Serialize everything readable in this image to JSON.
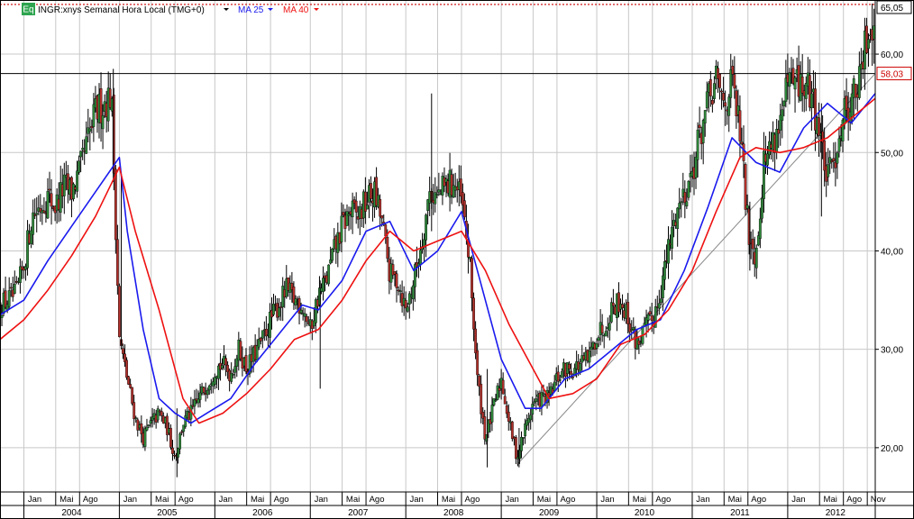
{
  "legend": {
    "badge": "Eq",
    "instrument": "INGR:xnys Semanal Hora Local (TMG+0)",
    "ma_short": "MA 25",
    "ma_long": "MA 40"
  },
  "chart_data": {
    "type": "candlestick",
    "title": "INGR:xnys Semanal Hora Local (TMG+0)",
    "x_axis": {
      "month_labels": [
        "Jan",
        "Mai",
        "Ago",
        "Jan",
        "Mai",
        "Ago",
        "Jan",
        "Mai",
        "Ago",
        "Jan",
        "Mai",
        "Ago",
        "Jan",
        "Mai",
        "Ago",
        "Jan",
        "Mai",
        "Ago",
        "Jan",
        "Mai",
        "Ago",
        "Jan",
        "Mai",
        "Ago",
        "Jan",
        "Mai",
        "Ago",
        "Nov"
      ],
      "year_labels": [
        "2004",
        "2005",
        "2006",
        "2007",
        "2008",
        "2009",
        "2010",
        "2011",
        "2012"
      ],
      "range": [
        "2003-10",
        "2012-12"
      ]
    },
    "y_axis": {
      "ticks": [
        "20,00",
        "30,00",
        "40,00",
        "50,00",
        "60,00"
      ],
      "tick_values": [
        20,
        30,
        40,
        50,
        60
      ],
      "range": [
        15.5,
        65.5
      ],
      "position": "right",
      "grid": true
    },
    "current_price": {
      "label": "65,05",
      "value": 65.05,
      "line_color": "#cc0000",
      "style": "dotted"
    },
    "horizontal_level": {
      "label": "58,03",
      "value": 58.03,
      "line_color": "#000000"
    },
    "trendline": {
      "from": {
        "date": "2009-03",
        "value": 18.3
      },
      "to": {
        "date": "2012-12",
        "value": 58.03
      },
      "color": "#888888"
    },
    "price_path": [
      {
        "d": "2003-10",
        "v": 34.5
      },
      {
        "d": "2003-12",
        "v": 35.5
      },
      {
        "d": "2004-01",
        "v": 38.5
      },
      {
        "d": "2004-02",
        "v": 43.5
      },
      {
        "d": "2004-03",
        "v": 44.5
      },
      {
        "d": "2004-04",
        "v": 45.5
      },
      {
        "d": "2004-05",
        "v": 44.5
      },
      {
        "d": "2004-06",
        "v": 46.5
      },
      {
        "d": "2004-07",
        "v": 46
      },
      {
        "d": "2004-08",
        "v": 48
      },
      {
        "d": "2004-09",
        "v": 51
      },
      {
        "d": "2004-10",
        "v": 54
      },
      {
        "d": "2004-11",
        "v": 55
      },
      {
        "d": "2004-12",
        "v": 56
      },
      {
        "d": "2005-01",
        "v": 31
      },
      {
        "d": "2005-02",
        "v": 27
      },
      {
        "d": "2005-03",
        "v": 23
      },
      {
        "d": "2005-04",
        "v": 21
      },
      {
        "d": "2005-05",
        "v": 22.5
      },
      {
        "d": "2005-06",
        "v": 23.5
      },
      {
        "d": "2005-07",
        "v": 22
      },
      {
        "d": "2005-08",
        "v": 19
      },
      {
        "d": "2005-09",
        "v": 22.5
      },
      {
        "d": "2005-10",
        "v": 23.5
      },
      {
        "d": "2005-11",
        "v": 25
      },
      {
        "d": "2005-12",
        "v": 26.5
      },
      {
        "d": "2006-01",
        "v": 28
      },
      {
        "d": "2006-02",
        "v": 28.5
      },
      {
        "d": "2006-03",
        "v": 27.5
      },
      {
        "d": "2006-04",
        "v": 30
      },
      {
        "d": "2006-05",
        "v": 28
      },
      {
        "d": "2006-06",
        "v": 29.5
      },
      {
        "d": "2006-07",
        "v": 31
      },
      {
        "d": "2006-08",
        "v": 33
      },
      {
        "d": "2006-09",
        "v": 34.5
      },
      {
        "d": "2006-10",
        "v": 36
      },
      {
        "d": "2006-11",
        "v": 35
      },
      {
        "d": "2006-12",
        "v": 34.5
      },
      {
        "d": "2007-01",
        "v": 32
      },
      {
        "d": "2007-02",
        "v": 35.5
      },
      {
        "d": "2007-03",
        "v": 37
      },
      {
        "d": "2007-04",
        "v": 40
      },
      {
        "d": "2007-05",
        "v": 42.5
      },
      {
        "d": "2007-06",
        "v": 44
      },
      {
        "d": "2007-07",
        "v": 43.5
      },
      {
        "d": "2007-08",
        "v": 45
      },
      {
        "d": "2007-09",
        "v": 46
      },
      {
        "d": "2007-10",
        "v": 43
      },
      {
        "d": "2007-11",
        "v": 37.5
      },
      {
        "d": "2007-12",
        "v": 37
      },
      {
        "d": "2008-01",
        "v": 34
      },
      {
        "d": "2008-02",
        "v": 37
      },
      {
        "d": "2008-03",
        "v": 41
      },
      {
        "d": "2008-04",
        "v": 46
      },
      {
        "d": "2008-05",
        "v": 45.5
      },
      {
        "d": "2008-06",
        "v": 46.5
      },
      {
        "d": "2008-07",
        "v": 47
      },
      {
        "d": "2008-08",
        "v": 45
      },
      {
        "d": "2008-09",
        "v": 39
      },
      {
        "d": "2008-10",
        "v": 27
      },
      {
        "d": "2008-11",
        "v": 21
      },
      {
        "d": "2008-12",
        "v": 24
      },
      {
        "d": "2009-01",
        "v": 27
      },
      {
        "d": "2009-02",
        "v": 22.5
      },
      {
        "d": "2009-03",
        "v": 19
      },
      {
        "d": "2009-04",
        "v": 22
      },
      {
        "d": "2009-05",
        "v": 24.5
      },
      {
        "d": "2009-06",
        "v": 25
      },
      {
        "d": "2009-07",
        "v": 25
      },
      {
        "d": "2009-08",
        "v": 27
      },
      {
        "d": "2009-09",
        "v": 28
      },
      {
        "d": "2009-10",
        "v": 28
      },
      {
        "d": "2009-11",
        "v": 28.5
      },
      {
        "d": "2009-12",
        "v": 29
      },
      {
        "d": "2010-01",
        "v": 31.5
      },
      {
        "d": "2010-02",
        "v": 32.5
      },
      {
        "d": "2010-03",
        "v": 34.5
      },
      {
        "d": "2010-04",
        "v": 35
      },
      {
        "d": "2010-05",
        "v": 33
      },
      {
        "d": "2010-06",
        "v": 30.5
      },
      {
        "d": "2010-07",
        "v": 32
      },
      {
        "d": "2010-08",
        "v": 33
      },
      {
        "d": "2010-09",
        "v": 36
      },
      {
        "d": "2010-10",
        "v": 40
      },
      {
        "d": "2010-11",
        "v": 44
      },
      {
        "d": "2010-12",
        "v": 46
      },
      {
        "d": "2011-01",
        "v": 48
      },
      {
        "d": "2011-02",
        "v": 52
      },
      {
        "d": "2011-03",
        "v": 55
      },
      {
        "d": "2011-04",
        "v": 57
      },
      {
        "d": "2011-05",
        "v": 55
      },
      {
        "d": "2011-06",
        "v": 57
      },
      {
        "d": "2011-07",
        "v": 52
      },
      {
        "d": "2011-08",
        "v": 42.5
      },
      {
        "d": "2011-09",
        "v": 39.5
      },
      {
        "d": "2011-10",
        "v": 49
      },
      {
        "d": "2011-11",
        "v": 51
      },
      {
        "d": "2011-12",
        "v": 53
      },
      {
        "d": "2012-01",
        "v": 56.5
      },
      {
        "d": "2012-02",
        "v": 57
      },
      {
        "d": "2012-03",
        "v": 56.5
      },
      {
        "d": "2012-04",
        "v": 56
      },
      {
        "d": "2012-05",
        "v": 52
      },
      {
        "d": "2012-06",
        "v": 47
      },
      {
        "d": "2012-07",
        "v": 50
      },
      {
        "d": "2012-08",
        "v": 54
      },
      {
        "d": "2012-09",
        "v": 55.5
      },
      {
        "d": "2012-10",
        "v": 57
      },
      {
        "d": "2012-11",
        "v": 62
      },
      {
        "d": "2012-12",
        "v": 64.5
      }
    ],
    "spikes": [
      {
        "d": "2004-12",
        "high": 58.5,
        "low": 47
      },
      {
        "d": "2005-01",
        "high": 48,
        "low": 30
      },
      {
        "d": "2005-08",
        "high": 24,
        "low": 17
      },
      {
        "d": "2007-02",
        "high": 37,
        "low": 26
      },
      {
        "d": "2008-04",
        "high": 56,
        "low": 42
      },
      {
        "d": "2008-11",
        "high": 28,
        "low": 18
      },
      {
        "d": "2009-03",
        "high": 22,
        "low": 18
      },
      {
        "d": "2011-08",
        "high": 45,
        "low": 38
      },
      {
        "d": "2012-05",
        "high": 55,
        "low": 43.5
      },
      {
        "d": "2012-12",
        "high": 65.05,
        "low": 60
      }
    ],
    "series": [
      {
        "name": "MA 25",
        "color": "#1a1aee",
        "points": [
          {
            "d": "2003-10",
            "v": 33.5
          },
          {
            "d": "2004-01",
            "v": 35
          },
          {
            "d": "2004-04",
            "v": 39
          },
          {
            "d": "2004-07",
            "v": 42.5
          },
          {
            "d": "2004-10",
            "v": 46
          },
          {
            "d": "2005-01",
            "v": 49.5
          },
          {
            "d": "2005-02",
            "v": 42
          },
          {
            "d": "2005-04",
            "v": 32
          },
          {
            "d": "2005-06",
            "v": 25
          },
          {
            "d": "2005-08",
            "v": 23.5
          },
          {
            "d": "2005-10",
            "v": 22.5
          },
          {
            "d": "2005-12",
            "v": 23.5
          },
          {
            "d": "2006-03",
            "v": 25
          },
          {
            "d": "2006-06",
            "v": 28.5
          },
          {
            "d": "2006-09",
            "v": 31.5
          },
          {
            "d": "2006-12",
            "v": 34.5
          },
          {
            "d": "2007-02",
            "v": 34
          },
          {
            "d": "2007-05",
            "v": 37
          },
          {
            "d": "2007-08",
            "v": 42
          },
          {
            "d": "2007-11",
            "v": 43
          },
          {
            "d": "2008-02",
            "v": 38
          },
          {
            "d": "2008-05",
            "v": 40
          },
          {
            "d": "2008-08",
            "v": 44
          },
          {
            "d": "2008-10",
            "v": 38
          },
          {
            "d": "2009-01",
            "v": 29
          },
          {
            "d": "2009-04",
            "v": 24
          },
          {
            "d": "2009-06",
            "v": 24
          },
          {
            "d": "2009-09",
            "v": 27
          },
          {
            "d": "2009-12",
            "v": 28
          },
          {
            "d": "2010-03",
            "v": 30
          },
          {
            "d": "2010-06",
            "v": 32
          },
          {
            "d": "2010-09",
            "v": 33
          },
          {
            "d": "2010-12",
            "v": 38
          },
          {
            "d": "2011-03",
            "v": 44.5
          },
          {
            "d": "2011-06",
            "v": 51.5
          },
          {
            "d": "2011-09",
            "v": 49
          },
          {
            "d": "2011-12",
            "v": 48
          },
          {
            "d": "2012-03",
            "v": 52.5
          },
          {
            "d": "2012-06",
            "v": 55
          },
          {
            "d": "2012-09",
            "v": 53
          },
          {
            "d": "2012-12",
            "v": 56
          }
        ]
      },
      {
        "name": "MA 40",
        "color": "#ee1111",
        "points": [
          {
            "d": "2003-10",
            "v": 31
          },
          {
            "d": "2004-01",
            "v": 33
          },
          {
            "d": "2004-04",
            "v": 36
          },
          {
            "d": "2004-07",
            "v": 39.5
          },
          {
            "d": "2004-10",
            "v": 43.5
          },
          {
            "d": "2005-01",
            "v": 48.5
          },
          {
            "d": "2005-03",
            "v": 42
          },
          {
            "d": "2005-06",
            "v": 34
          },
          {
            "d": "2005-09",
            "v": 25
          },
          {
            "d": "2005-11",
            "v": 22.5
          },
          {
            "d": "2006-02",
            "v": 23.5
          },
          {
            "d": "2006-05",
            "v": 25.5
          },
          {
            "d": "2006-08",
            "v": 28
          },
          {
            "d": "2006-11",
            "v": 31
          },
          {
            "d": "2007-02",
            "v": 32
          },
          {
            "d": "2007-05",
            "v": 35
          },
          {
            "d": "2007-08",
            "v": 39
          },
          {
            "d": "2007-11",
            "v": 42
          },
          {
            "d": "2008-02",
            "v": 40
          },
          {
            "d": "2008-05",
            "v": 41
          },
          {
            "d": "2008-08",
            "v": 42
          },
          {
            "d": "2008-11",
            "v": 38
          },
          {
            "d": "2009-02",
            "v": 32.5
          },
          {
            "d": "2009-05",
            "v": 28
          },
          {
            "d": "2009-07",
            "v": 25
          },
          {
            "d": "2009-10",
            "v": 25.5
          },
          {
            "d": "2010-01",
            "v": 27
          },
          {
            "d": "2010-04",
            "v": 30.5
          },
          {
            "d": "2010-07",
            "v": 31.5
          },
          {
            "d": "2010-10",
            "v": 34
          },
          {
            "d": "2011-01",
            "v": 38
          },
          {
            "d": "2011-04",
            "v": 44
          },
          {
            "d": "2011-07",
            "v": 49.5
          },
          {
            "d": "2011-09",
            "v": 50.5
          },
          {
            "d": "2011-12",
            "v": 50
          },
          {
            "d": "2012-03",
            "v": 50.5
          },
          {
            "d": "2012-06",
            "v": 51.5
          },
          {
            "d": "2012-09",
            "v": 53.5
          },
          {
            "d": "2012-12",
            "v": 55.5
          }
        ]
      }
    ]
  }
}
